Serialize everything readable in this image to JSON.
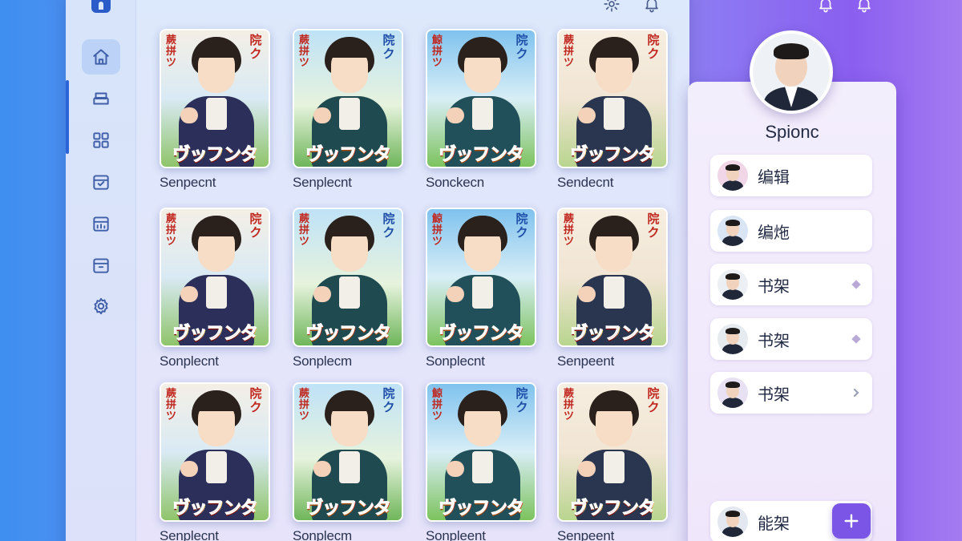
{
  "window": {
    "colors": {
      "accent": "#2b63d8",
      "add_button": "#7a55e6"
    }
  },
  "sidebar": {
    "items": [
      {
        "icon": "home-icon",
        "active": true
      },
      {
        "icon": "stack-icon",
        "active": false
      },
      {
        "icon": "grid-icon",
        "active": false
      },
      {
        "icon": "inbox-icon",
        "active": false
      },
      {
        "icon": "chart-box-icon",
        "active": false
      },
      {
        "icon": "archive-icon",
        "active": false
      },
      {
        "icon": "gear-icon",
        "active": false
      }
    ]
  },
  "topbar": {
    "icons": [
      "settings-icon",
      "bell-icon",
      "bell-icon",
      "bell-icon"
    ]
  },
  "books": [
    {
      "label": "Senpecnt",
      "left_text": "蕨拼ツ",
      "right_text": "院ク",
      "band_text": "ヴッフンタ"
    },
    {
      "label": "Senplecnt",
      "left_text": "蕨拼ツ",
      "right_text": "院ク",
      "band_text": "ヴッフンタ"
    },
    {
      "label": "Sonckecn",
      "left_text": "鯨拼ツ",
      "right_text": "院ク",
      "band_text": "ヴッフンタ"
    },
    {
      "label": "Sendecnt",
      "left_text": "蕨拼ツ",
      "right_text": "院ク",
      "band_text": "ヴッフンタ"
    },
    {
      "label": "Sonplecnt",
      "left_text": "蕨拼ツ",
      "right_text": "院ク",
      "band_text": "ヴッフンタ"
    },
    {
      "label": "Sonplecm",
      "left_text": "蕨拼ツ",
      "right_text": "院ク",
      "band_text": "ヴッフンタ"
    },
    {
      "label": "Sonplecnt",
      "left_text": "鯨拼ツ",
      "right_text": "院ク",
      "band_text": "ヴッフンタ"
    },
    {
      "label": "Senpeent",
      "left_text": "蕨拼ツ",
      "right_text": "院ク",
      "band_text": "ヴッフンタ"
    },
    {
      "label": "Senplecnt",
      "left_text": "蕨拼ツ",
      "right_text": "院ク",
      "band_text": "ヴッフンタ"
    },
    {
      "label": "Sonplecm",
      "left_text": "蕨拼ツ",
      "right_text": "院ク",
      "band_text": "ヴッフンタ"
    },
    {
      "label": "Sonpleent",
      "left_text": "鯨拼ツ",
      "right_text": "院ク",
      "band_text": "ヴッフンタ"
    },
    {
      "label": "Senpeent",
      "left_text": "蕨拼ツ",
      "right_text": "院ク",
      "band_text": "ヴッフンタ"
    }
  ],
  "profile": {
    "name": "Spionc"
  },
  "menu": [
    {
      "label": "编辑",
      "trail": ""
    },
    {
      "label": "编炧",
      "trail": ""
    },
    {
      "label": "书架",
      "trail": "diamond"
    },
    {
      "label": "书架",
      "trail": "diamond"
    },
    {
      "label": "书架",
      "trail": "chevron"
    },
    {
      "label": "能架",
      "trail": ""
    }
  ],
  "add_button": {
    "icon": "plus-icon"
  }
}
